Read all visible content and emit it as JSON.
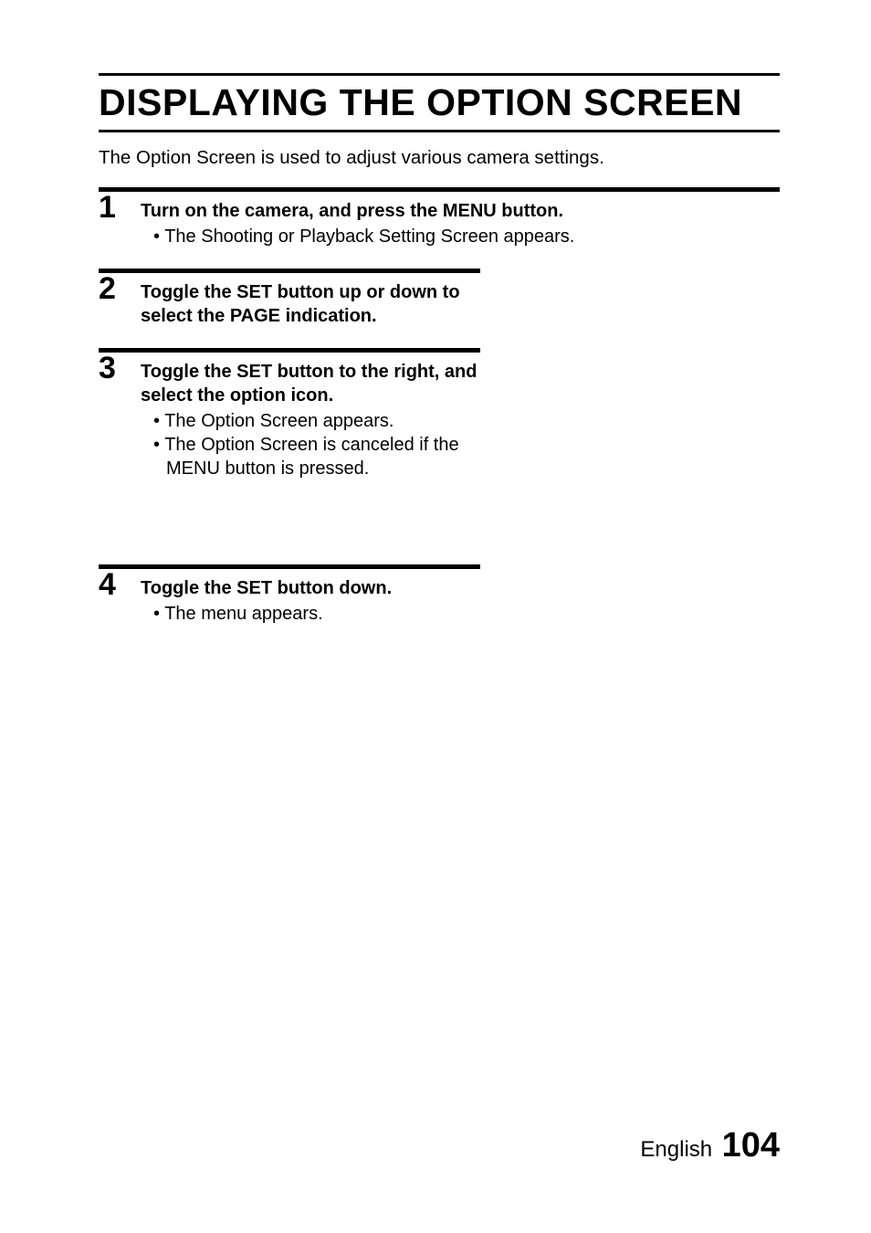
{
  "title": "DISPLAYING THE OPTION SCREEN",
  "intro": "The Option Screen is used to adjust various camera settings.",
  "steps": [
    {
      "num": "1",
      "heading": "Turn on the camera, and press the MENU button.",
      "bullets": [
        "The Shooting or Playback Setting Screen appears."
      ],
      "width": "full"
    },
    {
      "num": "2",
      "heading": "Toggle the SET button up or down to select the PAGE indication.",
      "bullets": [],
      "width": "half"
    },
    {
      "num": "3",
      "heading": "Toggle the SET button to the right, and select the option icon.",
      "bullets": [
        "The Option Screen appears.",
        "The Option Screen is canceled if the MENU button is pressed."
      ],
      "width": "half"
    },
    {
      "num": "4",
      "heading": "Toggle the SET button down.",
      "bullets": [
        "The menu appears."
      ],
      "width": "half"
    }
  ],
  "footer": {
    "language": "English",
    "page": "104"
  }
}
